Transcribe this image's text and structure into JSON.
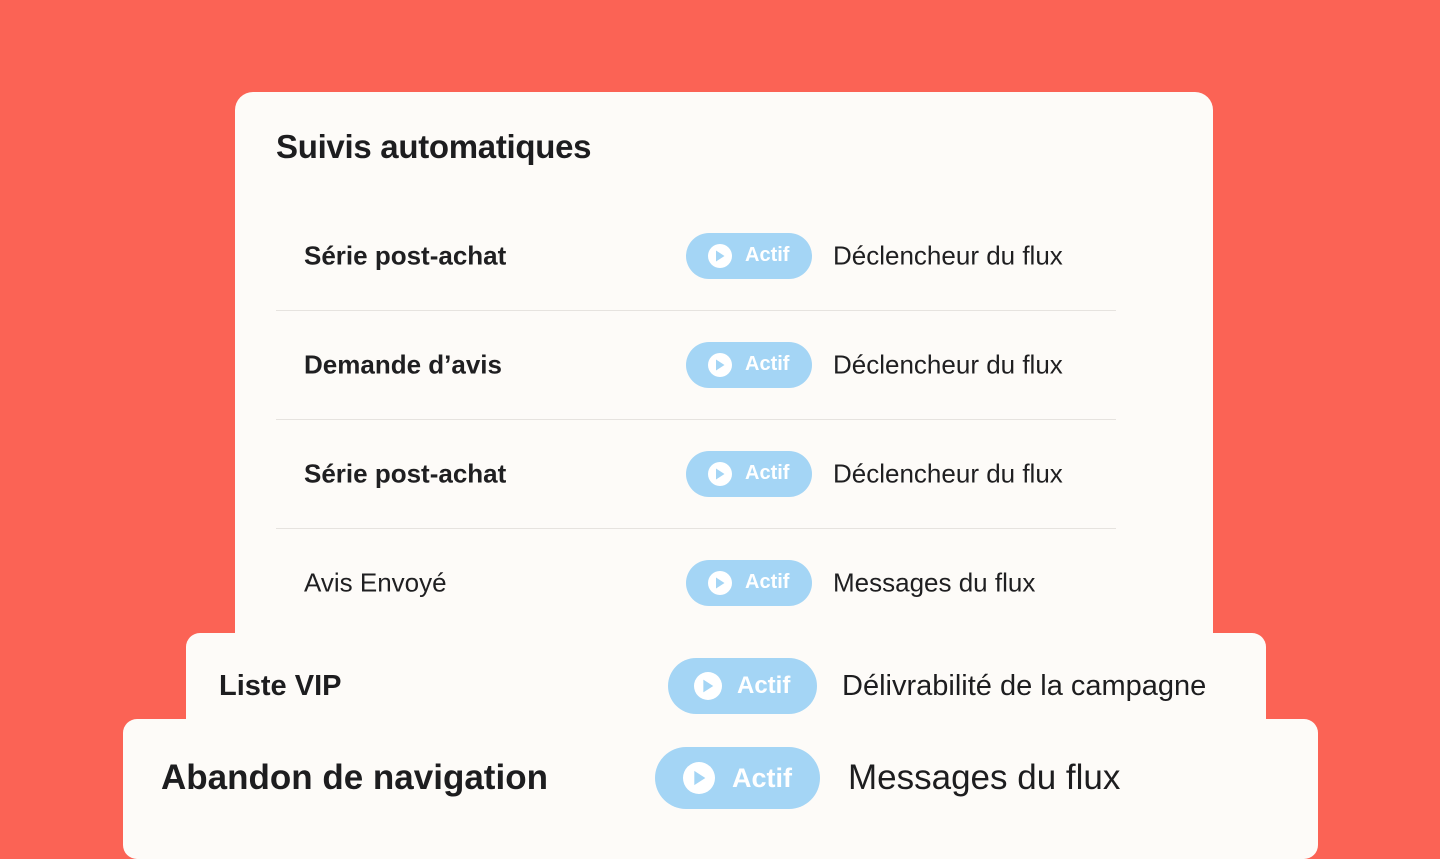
{
  "panel": {
    "title": "Suivis automatiques",
    "rows": [
      {
        "name": "Série post-achat",
        "status": "Actif",
        "trigger": "Déclencheur du flux"
      },
      {
        "name": "Demande d’avis",
        "status": "Actif",
        "trigger": "Déclencheur du flux"
      },
      {
        "name": "Série post-achat",
        "status": "Actif",
        "trigger": "Déclencheur du flux"
      },
      {
        "name": "Avis Envoyé",
        "status": "Actif",
        "trigger": "Messages du flux"
      }
    ]
  },
  "vip_card": {
    "name": "Liste VIP",
    "status": "Actif",
    "trigger": "Délivrabilité de la campagne"
  },
  "nav_card": {
    "name": "Abandon de navigation",
    "status": "Actif",
    "trigger": "Messages du flux"
  },
  "icons": {
    "status": "play-circle-icon"
  },
  "colors": {
    "background": "#fb6355",
    "card": "#fdfbf8",
    "badge": "#a4d5f5",
    "text": "#1d1d1f"
  }
}
